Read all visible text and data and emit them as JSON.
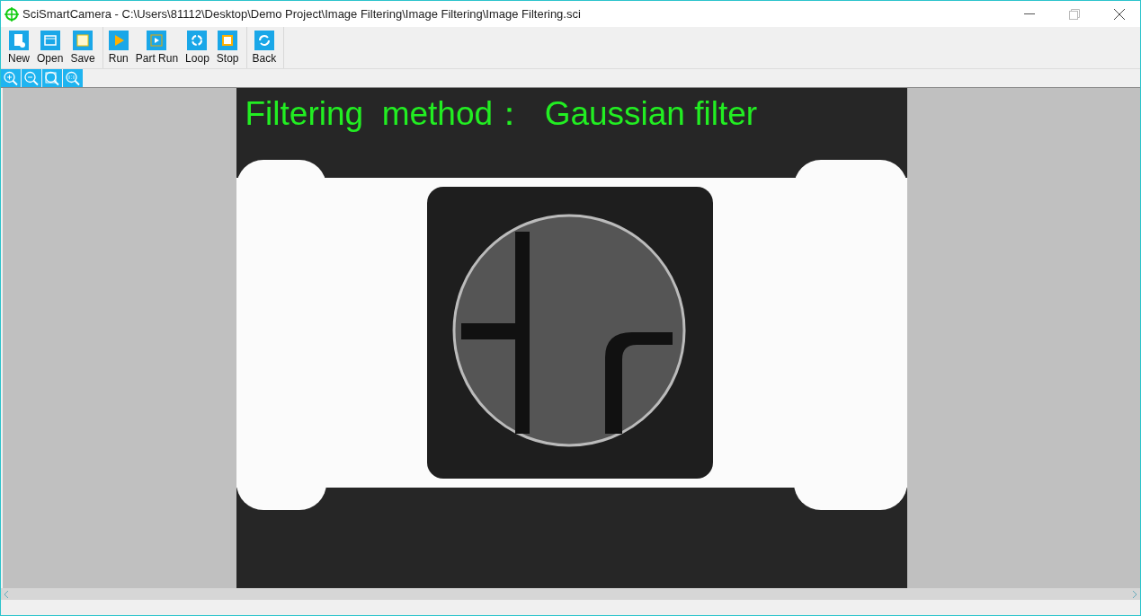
{
  "window": {
    "title": "SciSmartCamera - C:\\Users\\81112\\Desktop\\Demo Project\\Image Filtering\\Image Filtering\\Image Filtering.sci"
  },
  "toolbar_groups": [
    [
      {
        "kind": "new",
        "label": "New"
      },
      {
        "kind": "open",
        "label": "Open"
      },
      {
        "kind": "save",
        "label": "Save"
      }
    ],
    [
      {
        "kind": "run",
        "label": "Run"
      },
      {
        "kind": "partrun",
        "label": "Part Run"
      },
      {
        "kind": "loop",
        "label": "Loop"
      },
      {
        "kind": "stop",
        "label": "Stop"
      }
    ],
    [
      {
        "kind": "back",
        "label": "Back"
      }
    ]
  ],
  "zoom_tools": [
    {
      "kind": "zoomin"
    },
    {
      "kind": "zoomout"
    },
    {
      "kind": "fit"
    },
    {
      "kind": "actual"
    }
  ],
  "image": {
    "overlay_text": "Filtering  method：  Gaussian filter"
  }
}
